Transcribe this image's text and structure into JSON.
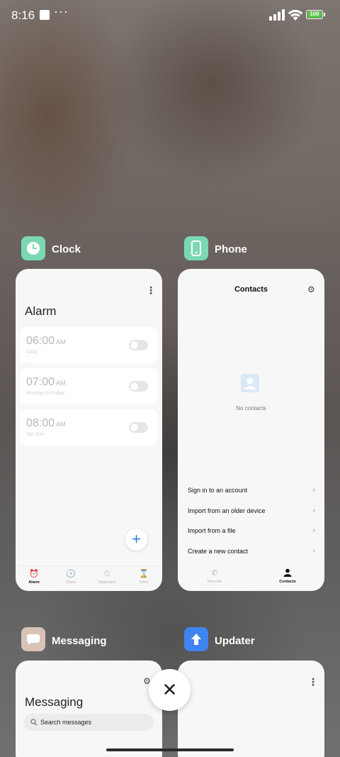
{
  "status_bar": {
    "time": "8:16",
    "more": "···",
    "battery": "100",
    "battery_color": "#59c94b"
  },
  "recents": {
    "cards": [
      {
        "app": "Clock",
        "icon": "clock-icon",
        "icon_color": "#7bd8b4",
        "screen": {
          "heading": "Alarm",
          "alarms": [
            {
              "time": "06:00",
              "ampm": "AM",
              "repeat": "Daily",
              "enabled": false
            },
            {
              "time": "07:00",
              "ampm": "AM",
              "repeat": "Monday to Friday",
              "enabled": false
            },
            {
              "time": "08:00",
              "ampm": "AM",
              "repeat": "Sat Sun",
              "enabled": false
            }
          ],
          "fab": "+",
          "tabs": [
            "Alarm",
            "Clock",
            "Stopwatch",
            "Timer"
          ],
          "active_tab": "Alarm"
        }
      },
      {
        "app": "Phone",
        "icon": "phone-icon",
        "icon_color": "#7bd8b4",
        "screen": {
          "title": "Contacts",
          "empty_text": "No contacts",
          "menu": [
            "Sign in to an account",
            "Import from an older device",
            "Import from a file",
            "Create a new contact"
          ],
          "tabs": [
            "Recents",
            "Contacts"
          ],
          "active_tab": "Contacts"
        }
      },
      {
        "app": "Messaging",
        "icon": "message-icon",
        "icon_color": "#d8c3b6",
        "screen": {
          "heading": "Messaging",
          "search_placeholder": "Search messages"
        }
      },
      {
        "app": "Updater",
        "icon": "upload-arrow-icon",
        "icon_color": "#3f84f0"
      }
    ]
  },
  "close_button": "✕"
}
